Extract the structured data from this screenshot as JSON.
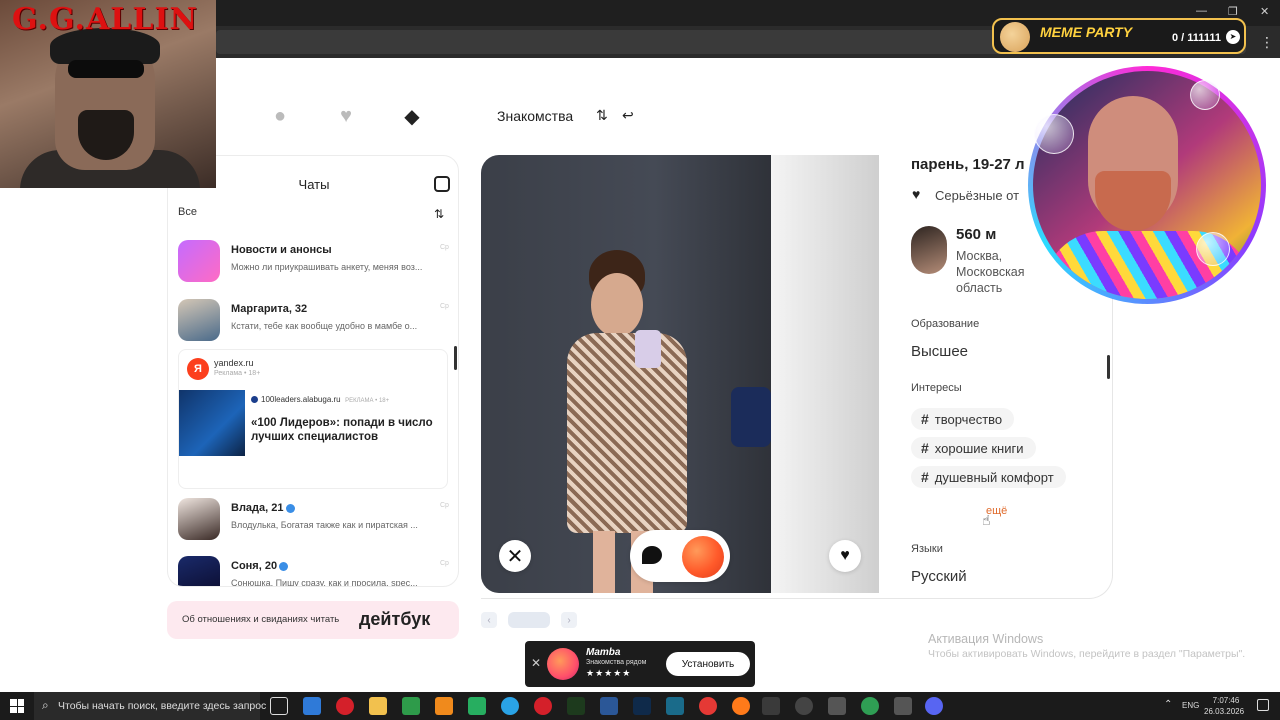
{
  "nav": {
    "title": "Знакомства",
    "icons": [
      "search-icon",
      "hearts-icon",
      "cards-icon",
      "filter-icon",
      "undo-icon"
    ]
  },
  "chats": {
    "title": "Чаты",
    "filter": "Все",
    "items": [
      {
        "name": "Новости и анонсы",
        "message": "Можно ли приукрашивать анкету, меняя воз...",
        "time": "Ср"
      },
      {
        "name": "Маргарита, 32",
        "message": "Кстати, тебе как вообще удобно в мамбе о...",
        "time": "Ср"
      },
      {
        "name": "Влада, 21",
        "message": "Влодулька, Богатая также как и пиратская ...",
        "time": "Ср"
      },
      {
        "name": "Соня, 20",
        "message": "Сонюшка, Пишу сразу, как и просила, spec...",
        "time": "Ср"
      }
    ],
    "ad": {
      "domain": "yandex.ru",
      "label": "Реклама • 18+",
      "ya": "Я",
      "source": "100leaders.alabuga.ru",
      "source_label": "РЕКЛАМА • 18+",
      "title": "«100 Лидеров»: попади в число лучших специалистов"
    }
  },
  "banner": {
    "text": "Об отношениях и свиданиях читать",
    "logo": "дейтбук"
  },
  "profile": {
    "title": "парень, 19-27 л",
    "goal": "Серьёзные от",
    "distance": "560 м",
    "city": "Москва, Московская область",
    "education_label": "Образование",
    "education_value": "Высшее",
    "interests_label": "Интересы",
    "interests": [
      "творчество",
      "хорошие книги",
      "душевный комфорт"
    ],
    "more": "ещё",
    "languages_label": "Языки",
    "languages_value": "Русский"
  },
  "watermark": {
    "title": "Активация Windows",
    "subtitle": "Чтобы активировать Windows, перейдите в раздел \"Параметры\"."
  },
  "mamba_ad": {
    "name": "Mamba",
    "subtitle": "Знакомства рядом",
    "stars": "★★★★★",
    "button": "Установить"
  },
  "overlay": {
    "left_title": "G.G.ALLIN",
    "meme_title": "MEME PARTY",
    "meme_count": "0 / 111111"
  },
  "taskbar": {
    "search_placeholder": "Чтобы начать поиск, введите здесь запрос",
    "lang": "ENG",
    "time": "7:07:46",
    "date": "26.03.2026"
  },
  "colors": {
    "accent": "#e06b2c",
    "banner_bg": "#fde9ef",
    "verified": "#3a8ee6"
  }
}
